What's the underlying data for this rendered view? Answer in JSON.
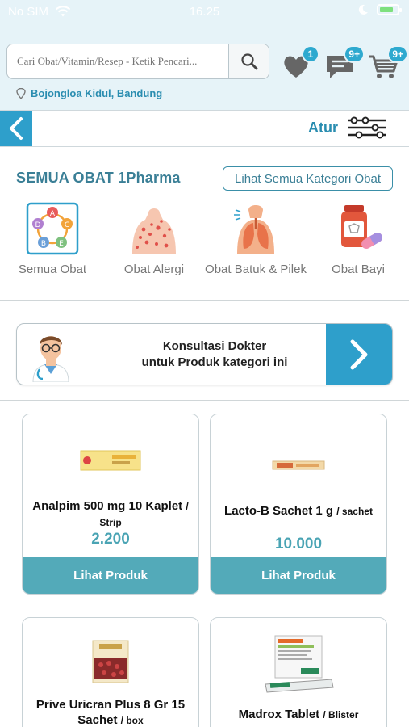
{
  "status_bar": {
    "carrier": "No SIM",
    "time": "16.25",
    "battery_percent": 80
  },
  "search": {
    "placeholder": "Cari Obat/Vitamin/Resep - Ketik Pencari..."
  },
  "header_icons": {
    "wishlist_badge": "1",
    "chat_badge": "9+",
    "cart_badge": "9+"
  },
  "location": {
    "label": "Bojongloa Kidul, Bandung"
  },
  "nav": {
    "atur_label": "Atur"
  },
  "category_section": {
    "title": "SEMUA OBAT 1Pharma",
    "see_all_label": "Lihat Semua Kategori Obat",
    "items": [
      {
        "label": "Semua Obat",
        "icon": "vitamin-abcde-icon"
      },
      {
        "label": "Obat Alergi",
        "icon": "allergy-skin-icon"
      },
      {
        "label": "Obat Batuk & Pilek",
        "icon": "lungs-cough-icon"
      },
      {
        "label": "Obat Bayi",
        "icon": "medicine-bottle-icon"
      }
    ]
  },
  "consult_banner": {
    "line1": "Konsultasi Dokter",
    "line2": "untuk Produk kategori ini"
  },
  "products": [
    {
      "name": "Analpim 500 mg 10 Kaplet",
      "unit": "/ Strip",
      "price": "2.200",
      "button": "Lihat Produk"
    },
    {
      "name": "Lacto-B Sachet 1 g",
      "unit": "/ sachet",
      "price": "10.000",
      "button": "Lihat Produk"
    },
    {
      "name": "Prive Uricran Plus 8 Gr 15 Sachet",
      "unit": "/ box",
      "price": "",
      "button": ""
    },
    {
      "name": "Madrox Tablet",
      "unit": "/ Blister",
      "price": "",
      "button": ""
    }
  ],
  "colors": {
    "brand": "#2e9fcb",
    "header_bg": "#e6f3f8",
    "button": "#53aab9",
    "price": "#4aa4b4"
  }
}
